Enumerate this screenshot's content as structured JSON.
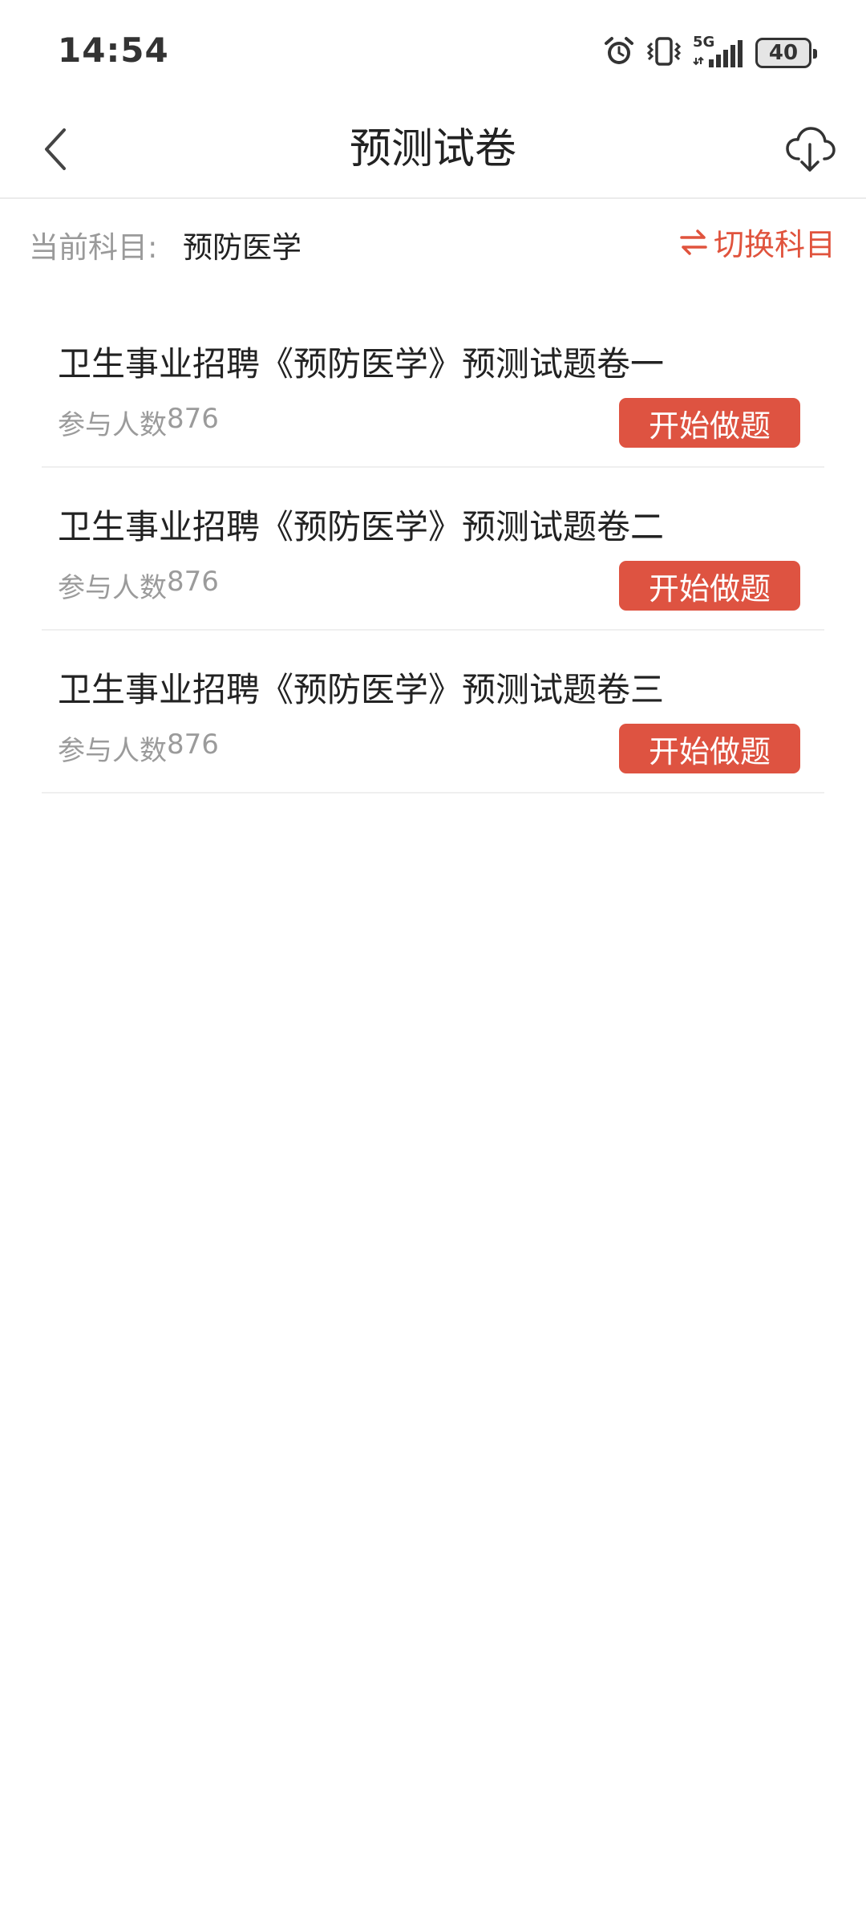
{
  "status_bar": {
    "time": "14:54",
    "network": "5G",
    "battery": "40"
  },
  "header": {
    "title": "预测试卷"
  },
  "subject": {
    "label": "当前科目:",
    "value": "预防医学",
    "switch_label": "切换科目",
    "accent_color": "#e0533d"
  },
  "papers": [
    {
      "title": "卫生事业招聘《预防医学》预测试题卷一",
      "participants_label": "参与人数",
      "participants_count": "876",
      "button_label": "开始做题"
    },
    {
      "title": "卫生事业招聘《预防医学》预测试题卷二",
      "participants_label": "参与人数",
      "participants_count": "876",
      "button_label": "开始做题"
    },
    {
      "title": "卫生事业招聘《预防医学》预测试题卷三",
      "participants_label": "参与人数",
      "participants_count": "876",
      "button_label": "开始做题"
    }
  ],
  "icons": {
    "alarm": "alarm-icon",
    "vibrate": "vibrate-icon",
    "signal": "signal-icon",
    "back": "back-arrow-icon",
    "download": "cloud-download-icon",
    "switch": "swap-icon"
  }
}
